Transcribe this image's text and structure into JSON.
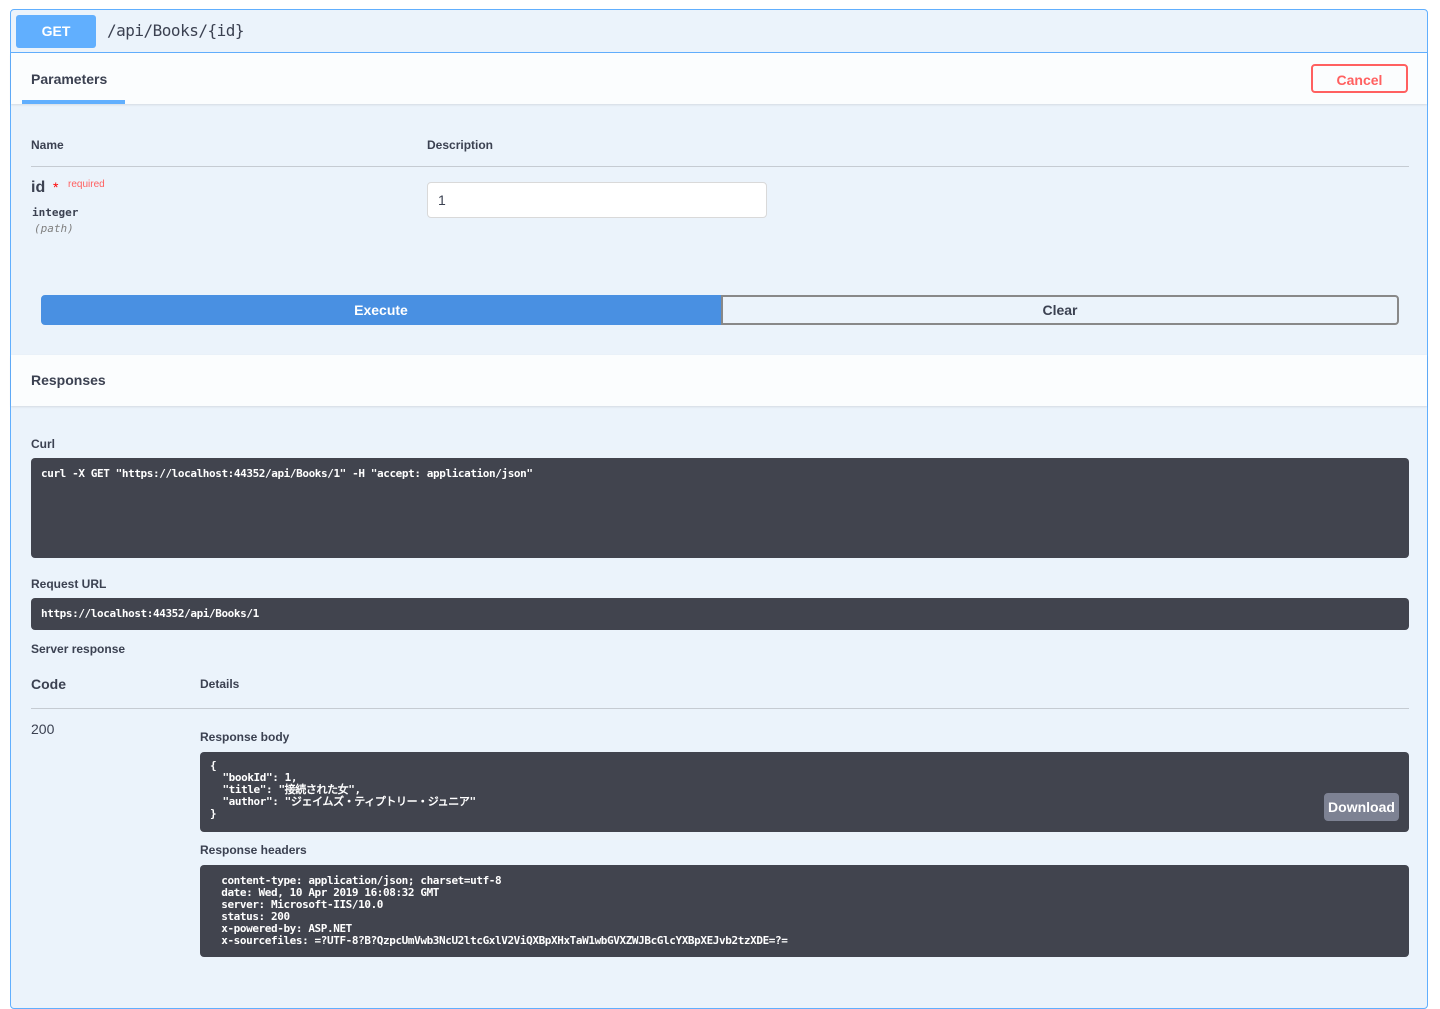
{
  "endpoint": {
    "method": "GET",
    "path": "/api/Books/{id}"
  },
  "parameters": {
    "tab_label": "Parameters",
    "cancel_label": "Cancel",
    "col_name": "Name",
    "col_description": "Description",
    "items": [
      {
        "name": "id",
        "required_star": "*",
        "required_label": "required",
        "type": "integer",
        "in": "(path)",
        "value": "1"
      }
    ]
  },
  "actions": {
    "execute_label": "Execute",
    "clear_label": "Clear"
  },
  "responses": {
    "title": "Responses",
    "curl_label": "Curl",
    "curl": "curl -X GET \"https://localhost:44352/api/Books/1\" -H \"accept: application/json\"",
    "request_url_label": "Request URL",
    "request_url": "https://localhost:44352/api/Books/1",
    "server_response_label": "Server response",
    "code_header": "Code",
    "details_header": "Details",
    "code": "200",
    "body_label": "Response body",
    "body": "{\n  \"bookId\": 1,\n  \"title\": \"接続された女\",\n  \"author\": \"ジェイムズ・ティプトリー・ジュニア\"\n}",
    "download_label": "Download",
    "headers_label": "Response headers",
    "headers": " content-type: application/json; charset=utf-8 \n date: Wed, 10 Apr 2019 16:08:32 GMT \n server: Microsoft-IIS/10.0 \n status: 200 \n x-powered-by: ASP.NET \n x-sourcefiles: =?UTF-8?B?QzpcUmVwb3NcU2ltcGxlV2ViQXBpXHxTaW1wbGVXZWJBcGlcYXBpXEJvb2tzXDE=?="
  },
  "colors": {
    "get_blue": "#61affe",
    "execute_blue": "#4990e2",
    "cancel_red": "#ff6060",
    "dark_panel": "#41444e",
    "panel_bg": "#ebf3fb"
  }
}
